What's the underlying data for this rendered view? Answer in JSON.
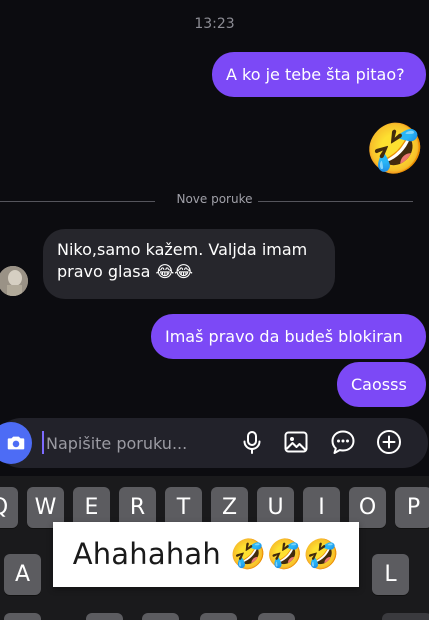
{
  "status": {
    "time": "13:23"
  },
  "messages": [
    {
      "direction": "outgoing",
      "text": "A ko je tebe šta pitao?"
    },
    {
      "direction": "outgoing",
      "text": "🤣",
      "kind": "emoji"
    },
    {
      "direction": "incoming",
      "text": "Niko,samo kažem. Valjda imam pravo glasa 😂😂"
    },
    {
      "direction": "outgoing",
      "text": "Imaš pravo da budeš blokiran"
    },
    {
      "direction": "outgoing",
      "text": "Caosss"
    }
  ],
  "divider": {
    "label": "Nove poruke"
  },
  "composer": {
    "placeholder": "Napišite poruku...",
    "icons": [
      "camera-icon",
      "microphone-icon",
      "image-icon",
      "sticker-icon",
      "add-icon"
    ]
  },
  "keyboard": {
    "row1": [
      "Q",
      "W",
      "E",
      "R",
      "T",
      "Z",
      "U",
      "I",
      "O",
      "P"
    ],
    "row2": [
      "A",
      "L"
    ]
  },
  "overlay": {
    "text": "Ahahahah 🤣🤣🤣"
  },
  "colors": {
    "background": "#0c0c10",
    "outgoing_bubble": "#7c49f6",
    "incoming_bubble": "#26262c",
    "camera_button": "#4d6cf5",
    "key": "#5c5c60"
  }
}
